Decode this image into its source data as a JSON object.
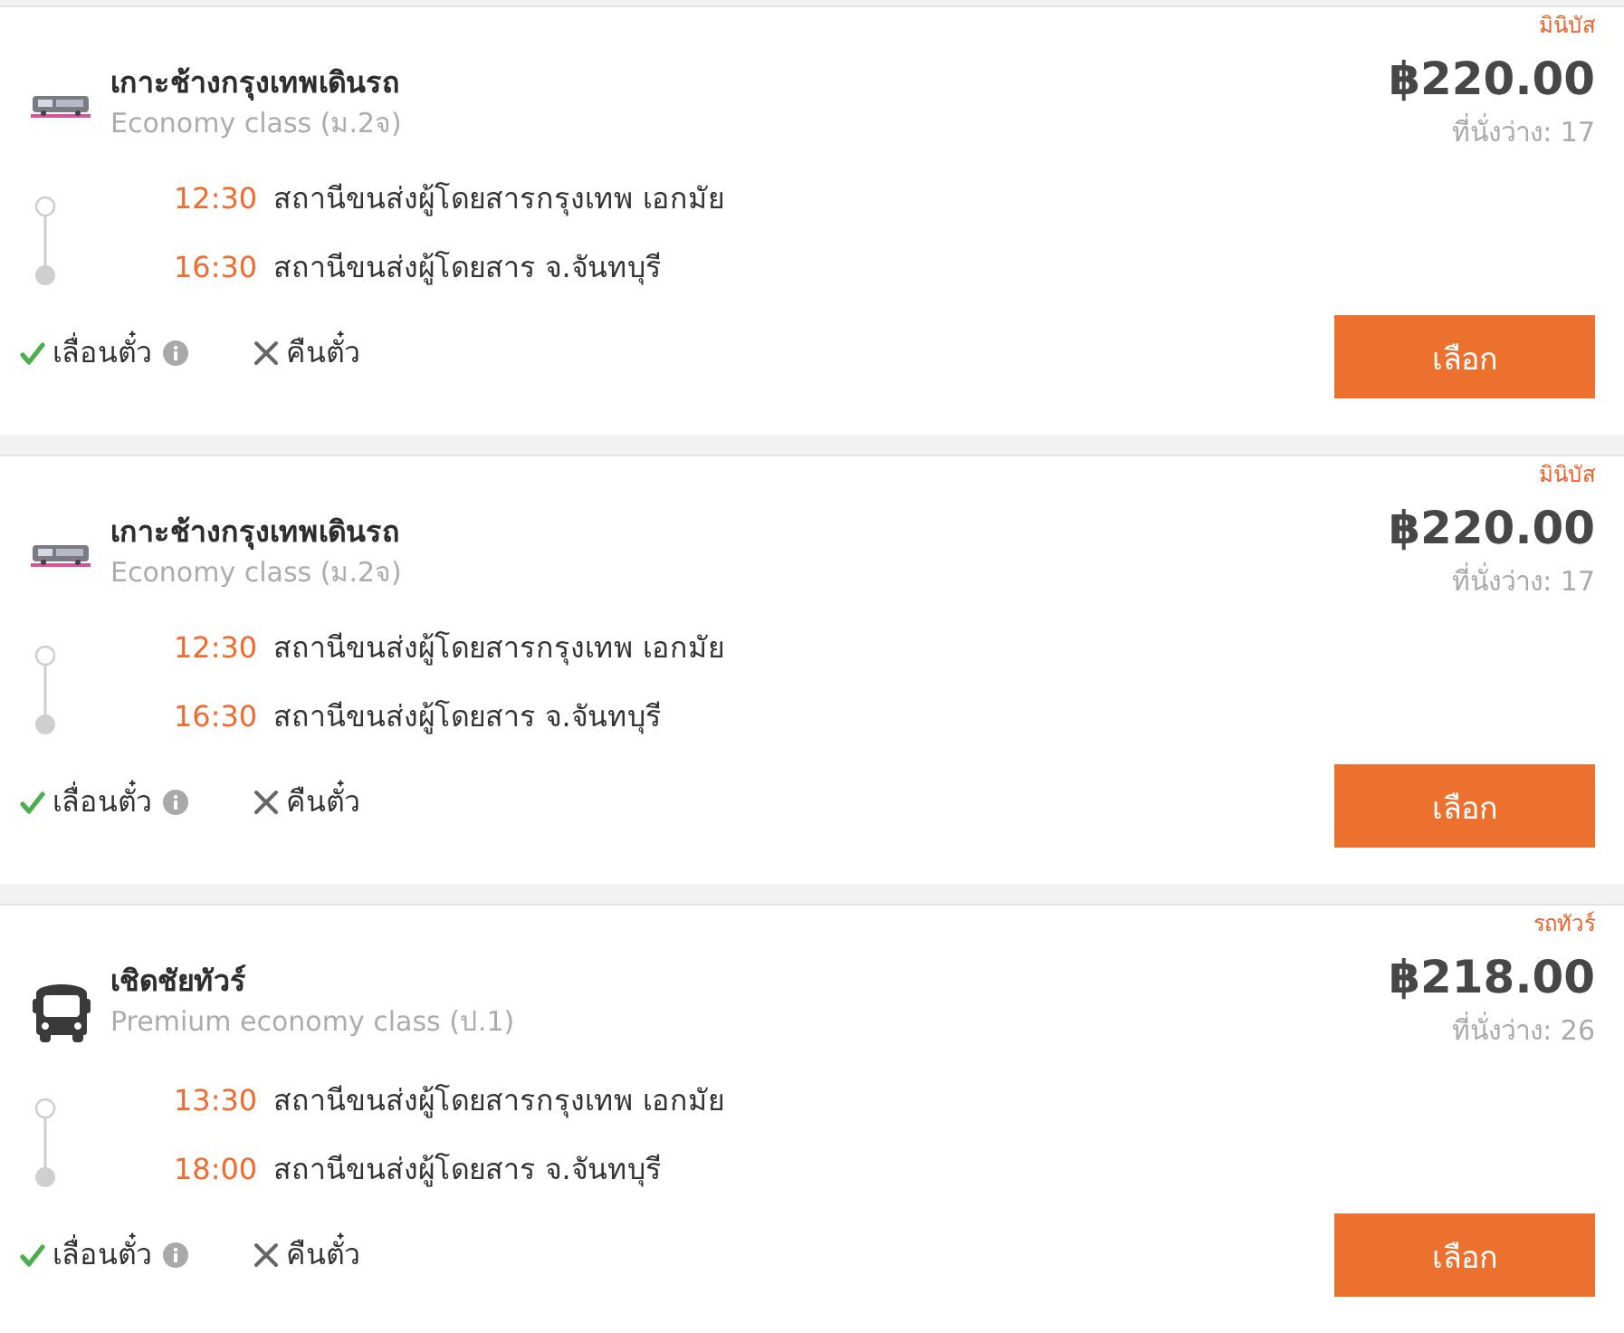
{
  "trips": [
    {
      "operator": {
        "kind": "brand_logo",
        "name": "เกาะช้างกรุงเทพเดินรถ"
      },
      "class": "Economy class (ม.2จ)",
      "stops": [
        {
          "kind": "departure",
          "time": "12:30",
          "station": "สถานีขนส่งผู้โดยสารกรุงเทพ เอกมัย"
        },
        {
          "kind": "arrival",
          "time": "16:30",
          "station": "สถานีขนส่งผู้โดยสาร จ.จันทบุรี"
        }
      ],
      "policies": [
        {
          "label": "เลื่อนตั๋ว",
          "allowed": true,
          "info": true
        },
        {
          "label": "คืนตั๋ว",
          "allowed": false,
          "info": false
        }
      ],
      "vehicle_type": "มินิบัส",
      "price": "฿220.00",
      "seats": "ที่นั่งว่าง: 17",
      "button": "เลือก"
    },
    {
      "operator": {
        "kind": "brand_logo",
        "name": "เกาะช้างกรุงเทพเดินรถ"
      },
      "class": "Economy class (ม.2จ)",
      "stops": [
        {
          "kind": "departure",
          "time": "12:30",
          "station": "สถานีขนส่งผู้โดยสารกรุงเทพ เอกมัย"
        },
        {
          "kind": "arrival",
          "time": "16:30",
          "station": "สถานีขนส่งผู้โดยสาร จ.จันทบุรี"
        }
      ],
      "policies": [
        {
          "label": "เลื่อนตั๋ว",
          "allowed": true,
          "info": true
        },
        {
          "label": "คืนตั๋ว",
          "allowed": false,
          "info": false
        }
      ],
      "vehicle_type": "มินิบัส",
      "price": "฿220.00",
      "seats": "ที่นั่งว่าง: 17",
      "button": "เลือก"
    },
    {
      "operator": {
        "kind": "bus_icon",
        "name": "เชิดชัยทัวร์"
      },
      "class": "Premium economy class (ป.1)",
      "stops": [
        {
          "kind": "departure",
          "time": "13:30",
          "station": "สถานีขนส่งผู้โดยสารกรุงเทพ เอกมัย"
        },
        {
          "kind": "arrival",
          "time": "18:00",
          "station": "สถานีขนส่งผู้โดยสาร จ.จันทบุรี"
        }
      ],
      "policies": [
        {
          "label": "เลื่อนตั๋ว",
          "allowed": true,
          "info": true
        },
        {
          "label": "คืนตั๋ว",
          "allowed": false,
          "info": false
        }
      ],
      "vehicle_type": "รถทัวร์",
      "price": "฿218.00",
      "seats": "ที่นั่งว่าง: 26",
      "button": "เลือก"
    }
  ]
}
